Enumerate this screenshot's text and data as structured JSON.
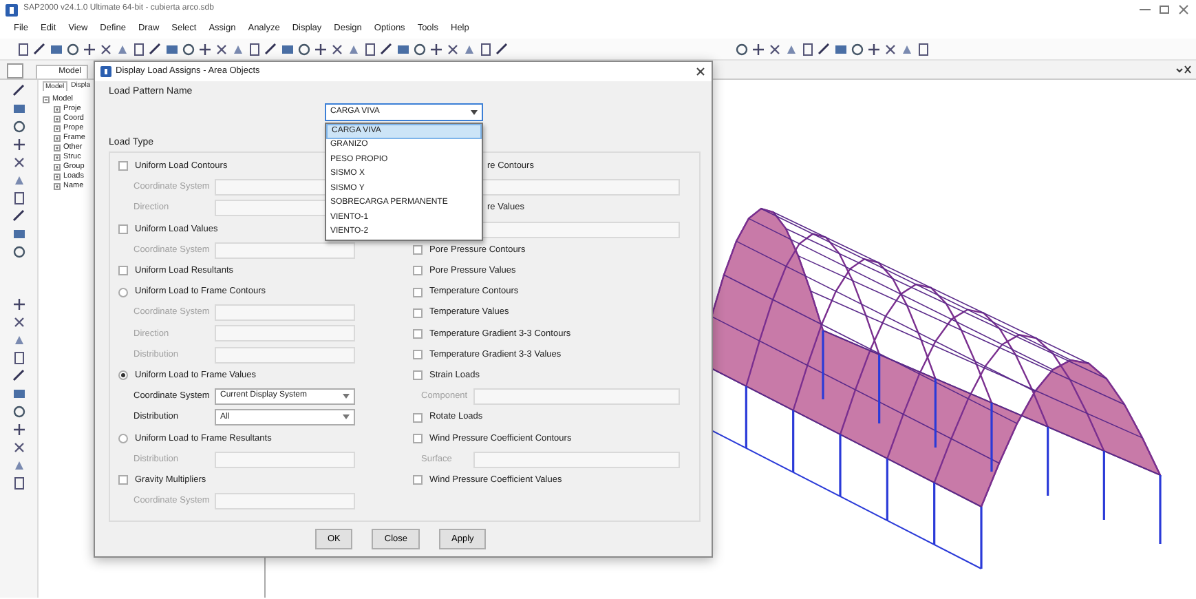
{
  "window": {
    "title": "SAP2000 v24.1.0 Ultimate 64-bit - cubierta arco.sdb"
  },
  "menu": [
    "File",
    "Edit",
    "View",
    "Define",
    "Draw",
    "Select",
    "Assign",
    "Analyze",
    "Display",
    "Design",
    "Options",
    "Tools",
    "Help"
  ],
  "document_tabs": [
    {
      "label": "Model",
      "selected": true
    }
  ],
  "model_explorer": {
    "tabs": [
      {
        "label": "Model",
        "selected": true
      },
      {
        "label": "Displa",
        "selected": false
      }
    ],
    "tree": {
      "label": "Model",
      "expanded": true,
      "children": [
        {
          "label": "Proje",
          "expanded": false
        },
        {
          "label": "Coord",
          "expanded": false
        },
        {
          "label": "Prope",
          "expanded": false
        },
        {
          "label": "Frame",
          "expanded": false
        },
        {
          "label": "Other",
          "expanded": false
        },
        {
          "label": "Struc",
          "expanded": false
        },
        {
          "label": "Group",
          "expanded": false
        },
        {
          "label": "Loads",
          "expanded": false
        },
        {
          "label": "Name",
          "expanded": false
        }
      ]
    }
  },
  "dialog": {
    "title": "Display Load Assigns - Area Objects",
    "load_pattern": {
      "label": "Load Pattern Name",
      "value": "CARGA VIVA",
      "expanded": true,
      "options": [
        {
          "label": "CARGA VIVA",
          "selected": true
        },
        {
          "label": "GRANIZO",
          "selected": false
        },
        {
          "label": "PESO PROPIO",
          "selected": false
        },
        {
          "label": "SISMO X",
          "selected": false
        },
        {
          "label": "SISMO Y",
          "selected": false
        },
        {
          "label": "SOBRECARGA PERMANENTE",
          "selected": false
        },
        {
          "label": "VIENTO-1",
          "selected": false
        },
        {
          "label": "VIENTO-2",
          "selected": false
        }
      ]
    },
    "group_label": "Load Type",
    "left_options": [
      {
        "kind": "check",
        "label": "Uniform Load Contours",
        "checked": false
      },
      {
        "kind": "field",
        "label": "Coordinate System",
        "disabled": true
      },
      {
        "kind": "field",
        "label": "Direction",
        "disabled": true
      },
      {
        "kind": "check",
        "label": "Uniform Load Values",
        "checked": false
      },
      {
        "kind": "field",
        "label": "Coordinate System",
        "disabled": true
      },
      {
        "kind": "check",
        "label": "Uniform Load Resultants",
        "checked": false
      },
      {
        "kind": "radio",
        "label": "Uniform Load to Frame Contours",
        "selected": false
      },
      {
        "kind": "field",
        "label": "Coordinate System",
        "disabled": true
      },
      {
        "kind": "field",
        "label": "Direction",
        "disabled": true
      },
      {
        "kind": "field",
        "label": "Distribution",
        "disabled": true
      },
      {
        "kind": "radio",
        "label": "Uniform Load to Frame Values",
        "selected": true
      },
      {
        "kind": "select",
        "label": "Coordinate System",
        "value": "Current Display System",
        "disabled": false
      },
      {
        "kind": "select",
        "label": "Distribution",
        "value": "All",
        "disabled": false
      },
      {
        "kind": "radio",
        "label": "Uniform Load to Frame Resultants",
        "selected": false
      },
      {
        "kind": "field",
        "label": "Distribution",
        "disabled": true
      },
      {
        "kind": "check",
        "label": "Gravity Multipliers",
        "checked": false
      },
      {
        "kind": "field",
        "label": "Coordinate System",
        "disabled": true
      }
    ],
    "right_options": [
      {
        "kind": "partial",
        "label": "re Contours"
      },
      {
        "kind": "field",
        "disabled": true
      },
      {
        "kind": "partial",
        "label": "re Values"
      },
      {
        "kind": "field",
        "disabled": true
      },
      {
        "kind": "check",
        "label": "Pore Pressure Contours",
        "checked": false
      },
      {
        "kind": "check",
        "label": "Pore Pressure Values",
        "checked": false
      },
      {
        "kind": "check",
        "label": "Temperature Contours",
        "checked": false
      },
      {
        "kind": "check",
        "label": "Temperature Values",
        "checked": false
      },
      {
        "kind": "check",
        "label": "Temperature Gradient 3-3 Contours",
        "checked": false
      },
      {
        "kind": "check",
        "label": "Temperature Gradient 3-3 Values",
        "checked": false
      },
      {
        "kind": "check",
        "label": "Strain Loads",
        "checked": false
      },
      {
        "kind": "field",
        "label": "Component",
        "disabled": true
      },
      {
        "kind": "check",
        "label": "Rotate Loads",
        "checked": false
      },
      {
        "kind": "check",
        "label": "Wind Pressure Coefficient Contours",
        "checked": false
      },
      {
        "kind": "field",
        "label": "Surface",
        "disabled": true
      },
      {
        "kind": "check",
        "label": "Wind Pressure Coefficient Values",
        "checked": false
      }
    ],
    "buttons": [
      "OK",
      "Close",
      "Apply"
    ]
  }
}
